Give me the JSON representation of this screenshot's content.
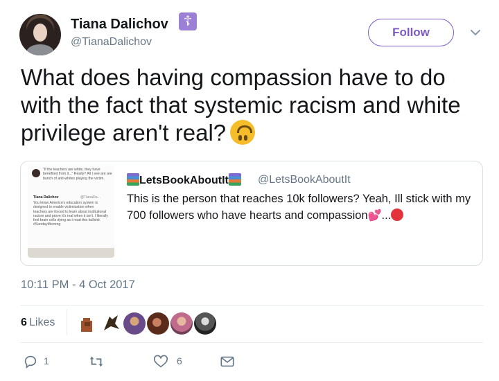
{
  "header": {
    "display_name": "Tiana Dalichov",
    "badge_glyph": "☦",
    "handle": "@TianaDalichov",
    "follow_label": "Follow"
  },
  "tweet": {
    "text": "What does having compassion have to do with the fact that systemic racism and white privilege aren't real?"
  },
  "quoted_tweet": {
    "name": "LetsBookAboutIt",
    "handle": "@LetsBookAboutIt",
    "text": "This is the person that reaches 10k followers? Yeah, Ill stick with my 700 followers who have hearts and compassion",
    "text_suffix": "...",
    "thumbnail": {
      "caption_top": "\"If the teachers are white, they have benefited from it...\" Really? All I see are are bunch of anti-whites playing the victim.",
      "inner_name": "Tiana Dalichov",
      "inner_handle": "@TianaDa...",
      "inner_text": "You know America's education system is designed to enable victimization when teachers are forced to learn about institutional racism and prove it's real when it isn't. I literally feel brain cells dying as I read this bullshit. #SundayMorning"
    }
  },
  "meta": {
    "timestamp": "10:11 PM - 4 Oct 2017",
    "likes_count": "6",
    "likes_label": "Likes"
  },
  "actions": {
    "reply_count": "1",
    "like_count": "6"
  },
  "colors": {
    "accent": "#7c5ac6",
    "secondary_text": "#657786",
    "divider": "#e6ecf0",
    "badge": "#9b80d6"
  }
}
